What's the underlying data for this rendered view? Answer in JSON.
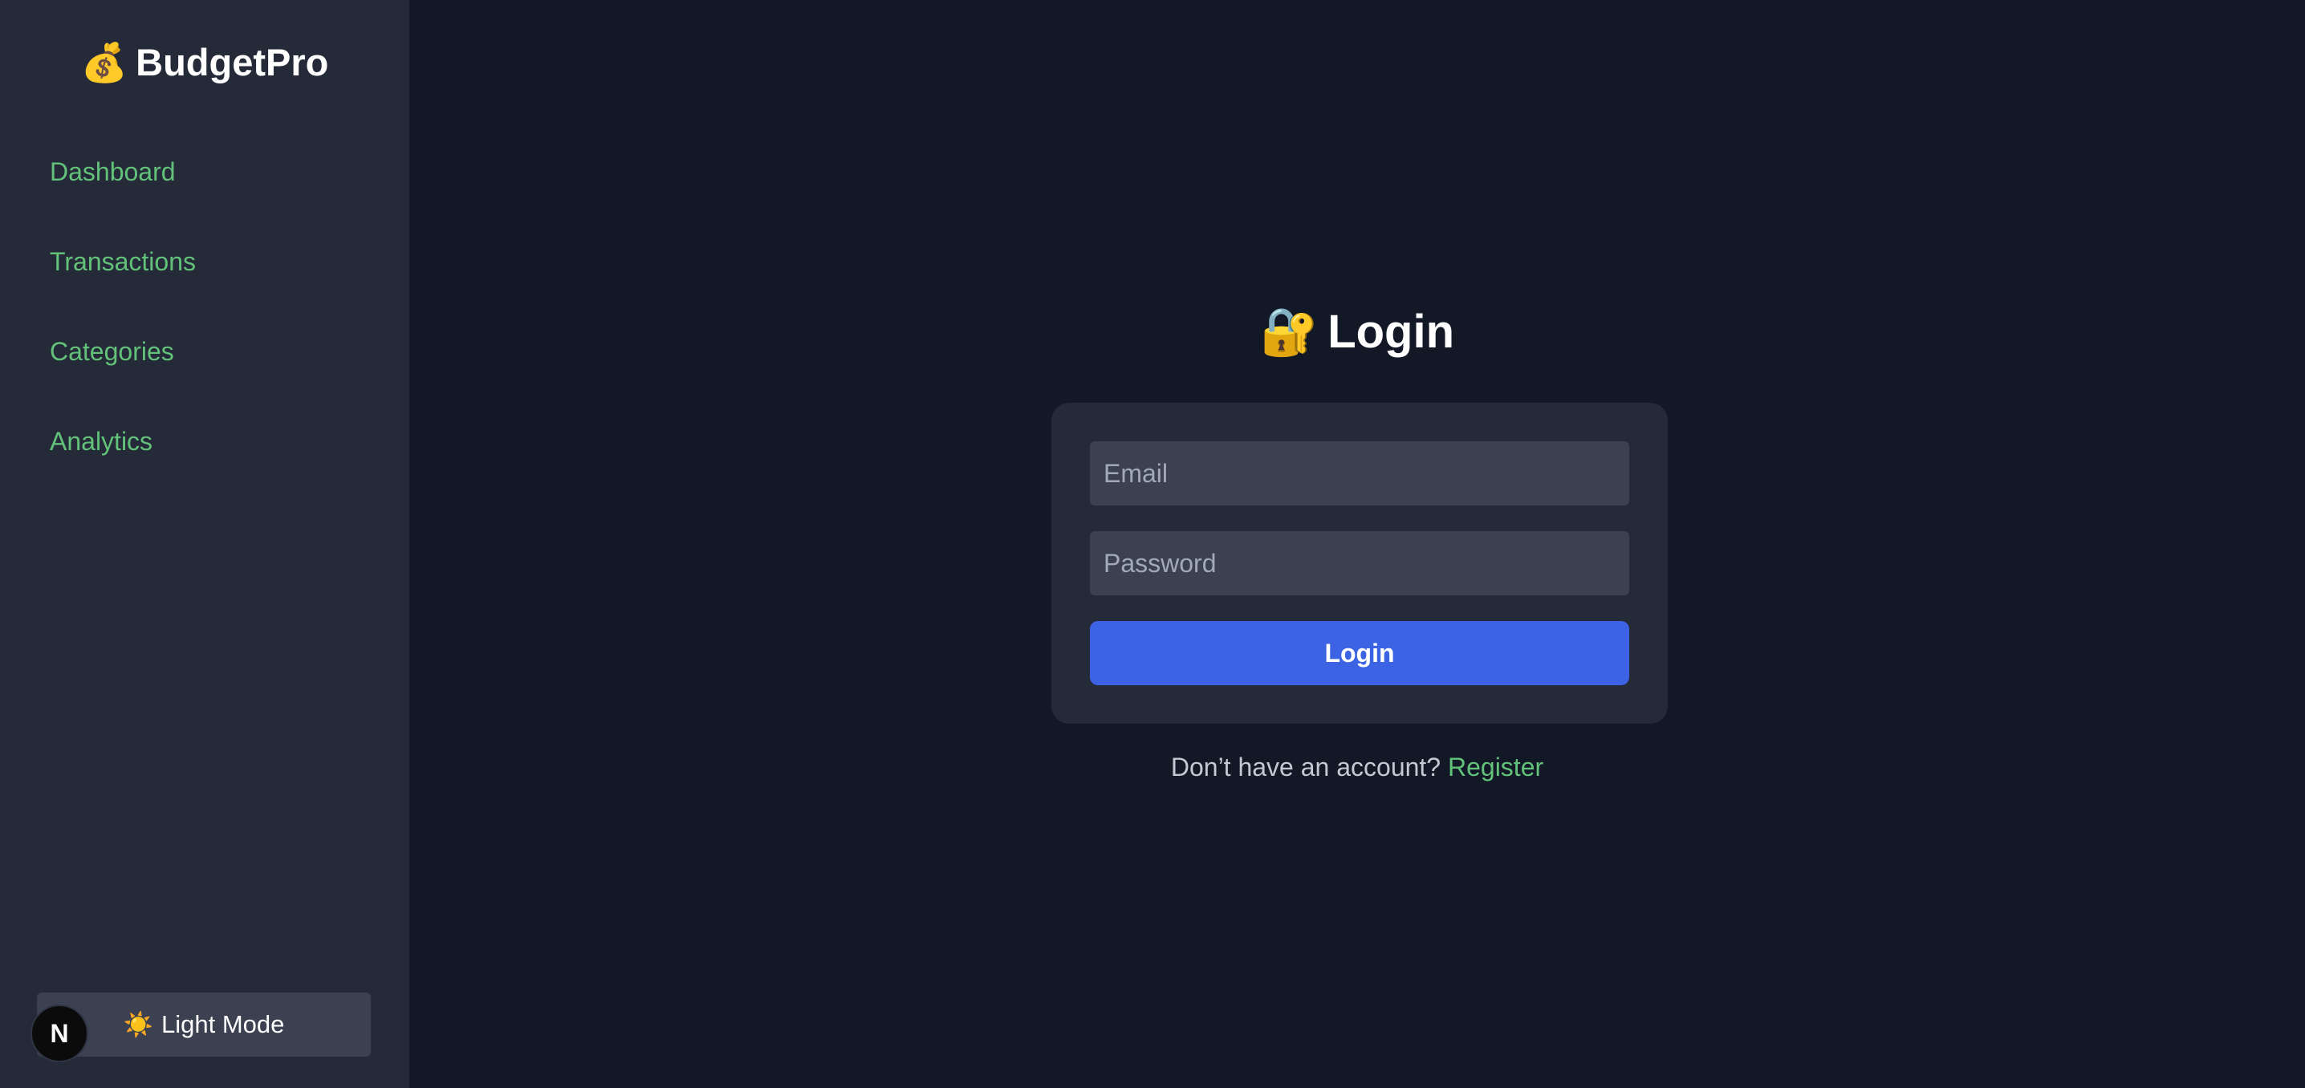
{
  "sidebar": {
    "brand": {
      "emoji": "💰",
      "name": "BudgetPro"
    },
    "nav": [
      {
        "label": "Dashboard"
      },
      {
        "label": "Transactions"
      },
      {
        "label": "Categories"
      },
      {
        "label": "Analytics"
      }
    ],
    "theme_toggle": {
      "emoji": "☀️",
      "label": "Light Mode"
    },
    "dev_badge": {
      "letter": "N",
      "icon": "nextjs-icon"
    }
  },
  "main": {
    "title": {
      "emoji": "🔐",
      "text": "Login"
    },
    "form": {
      "email": {
        "placeholder": "Email",
        "value": ""
      },
      "password": {
        "placeholder": "Password",
        "value": ""
      },
      "submit_label": "Login"
    },
    "register": {
      "prompt": "Don’t have an account?",
      "link_label": "Register"
    }
  },
  "colors": {
    "background": "#121826",
    "sidebar": "#242a38",
    "nav_link": "#63c27a",
    "primary_button": "#3b63e3",
    "input_bg": "#3b4150"
  }
}
